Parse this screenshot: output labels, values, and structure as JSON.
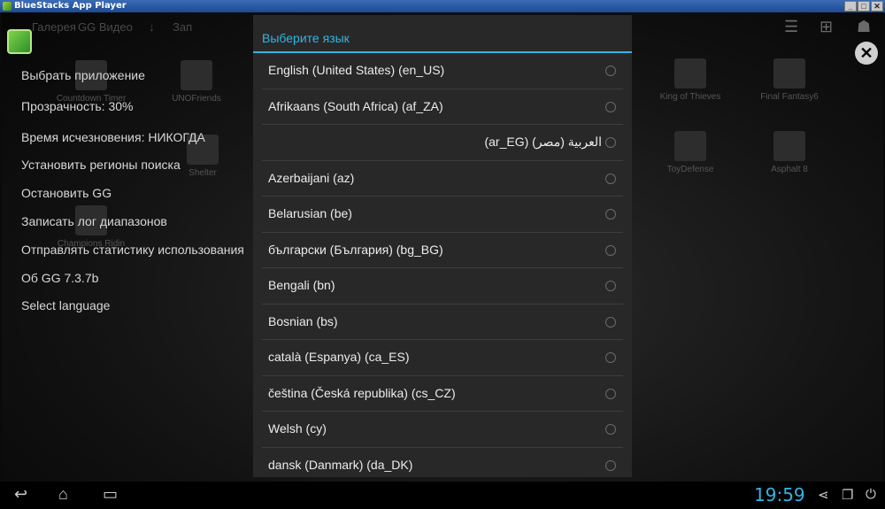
{
  "window": {
    "title": "BlueStacks App Player",
    "minimize": "_",
    "maximize": "□",
    "close": "✕"
  },
  "background": {
    "tabs": [
      "Галерея",
      "GG Видео",
      "↓",
      "Зап"
    ],
    "apps": [
      {
        "label": "Countdown Timer",
        "icon": "countdown-icon"
      },
      {
        "label": "UNOFriends",
        "icon": "uno-icon"
      },
      {
        "label": "King of Thieves",
        "icon": "thieves-icon"
      },
      {
        "label": "Final Fantasy6",
        "icon": "ff6-icon"
      },
      {
        "label": "Shelter",
        "icon": "shelter-icon"
      },
      {
        "label": "ToyDefense",
        "icon": "toydefense-icon"
      },
      {
        "label": "Asphalt 8",
        "icon": "asphalt-icon"
      },
      {
        "label": "Champions Ridin",
        "icon": "champions-icon"
      }
    ]
  },
  "gg_menu": {
    "items": [
      "Выбрать приложение",
      "Прозрачность: 30%",
      "Время исчезновения: НИКОГДА",
      "Установить регионы поиска",
      "Остановить GG",
      "Записать лог диапазонов",
      "Отправлять статистику использования",
      "Об GG 7.3.7b",
      "Select language"
    ]
  },
  "dialog": {
    "title": "Выберите язык",
    "languages": [
      "English (United States) (en_US)",
      "Afrikaans (South Africa) (af_ZA)",
      "العربية (مصر) (ar_EG)",
      "Azerbaijani (az)",
      "Belarusian (be)",
      "български (България) (bg_BG)",
      "Bengali (bn)",
      "Bosnian (bs)",
      "català (Espanya) (ca_ES)",
      "čeština (Česká republika) (cs_CZ)",
      "Welsh (cy)",
      "dansk (Danmark) (da_DK)"
    ]
  },
  "overlay": {
    "close_glyph": "✕"
  },
  "navbar": {
    "back_glyph": "↩",
    "home_glyph": "⌂",
    "recents_glyph": "▭",
    "clock": "19:59",
    "share_glyph": "⋖",
    "window_glyph": "❐",
    "power_glyph": "⏻"
  },
  "colors": {
    "accent": "#33b5e5",
    "dialog_bg": "#282828"
  }
}
